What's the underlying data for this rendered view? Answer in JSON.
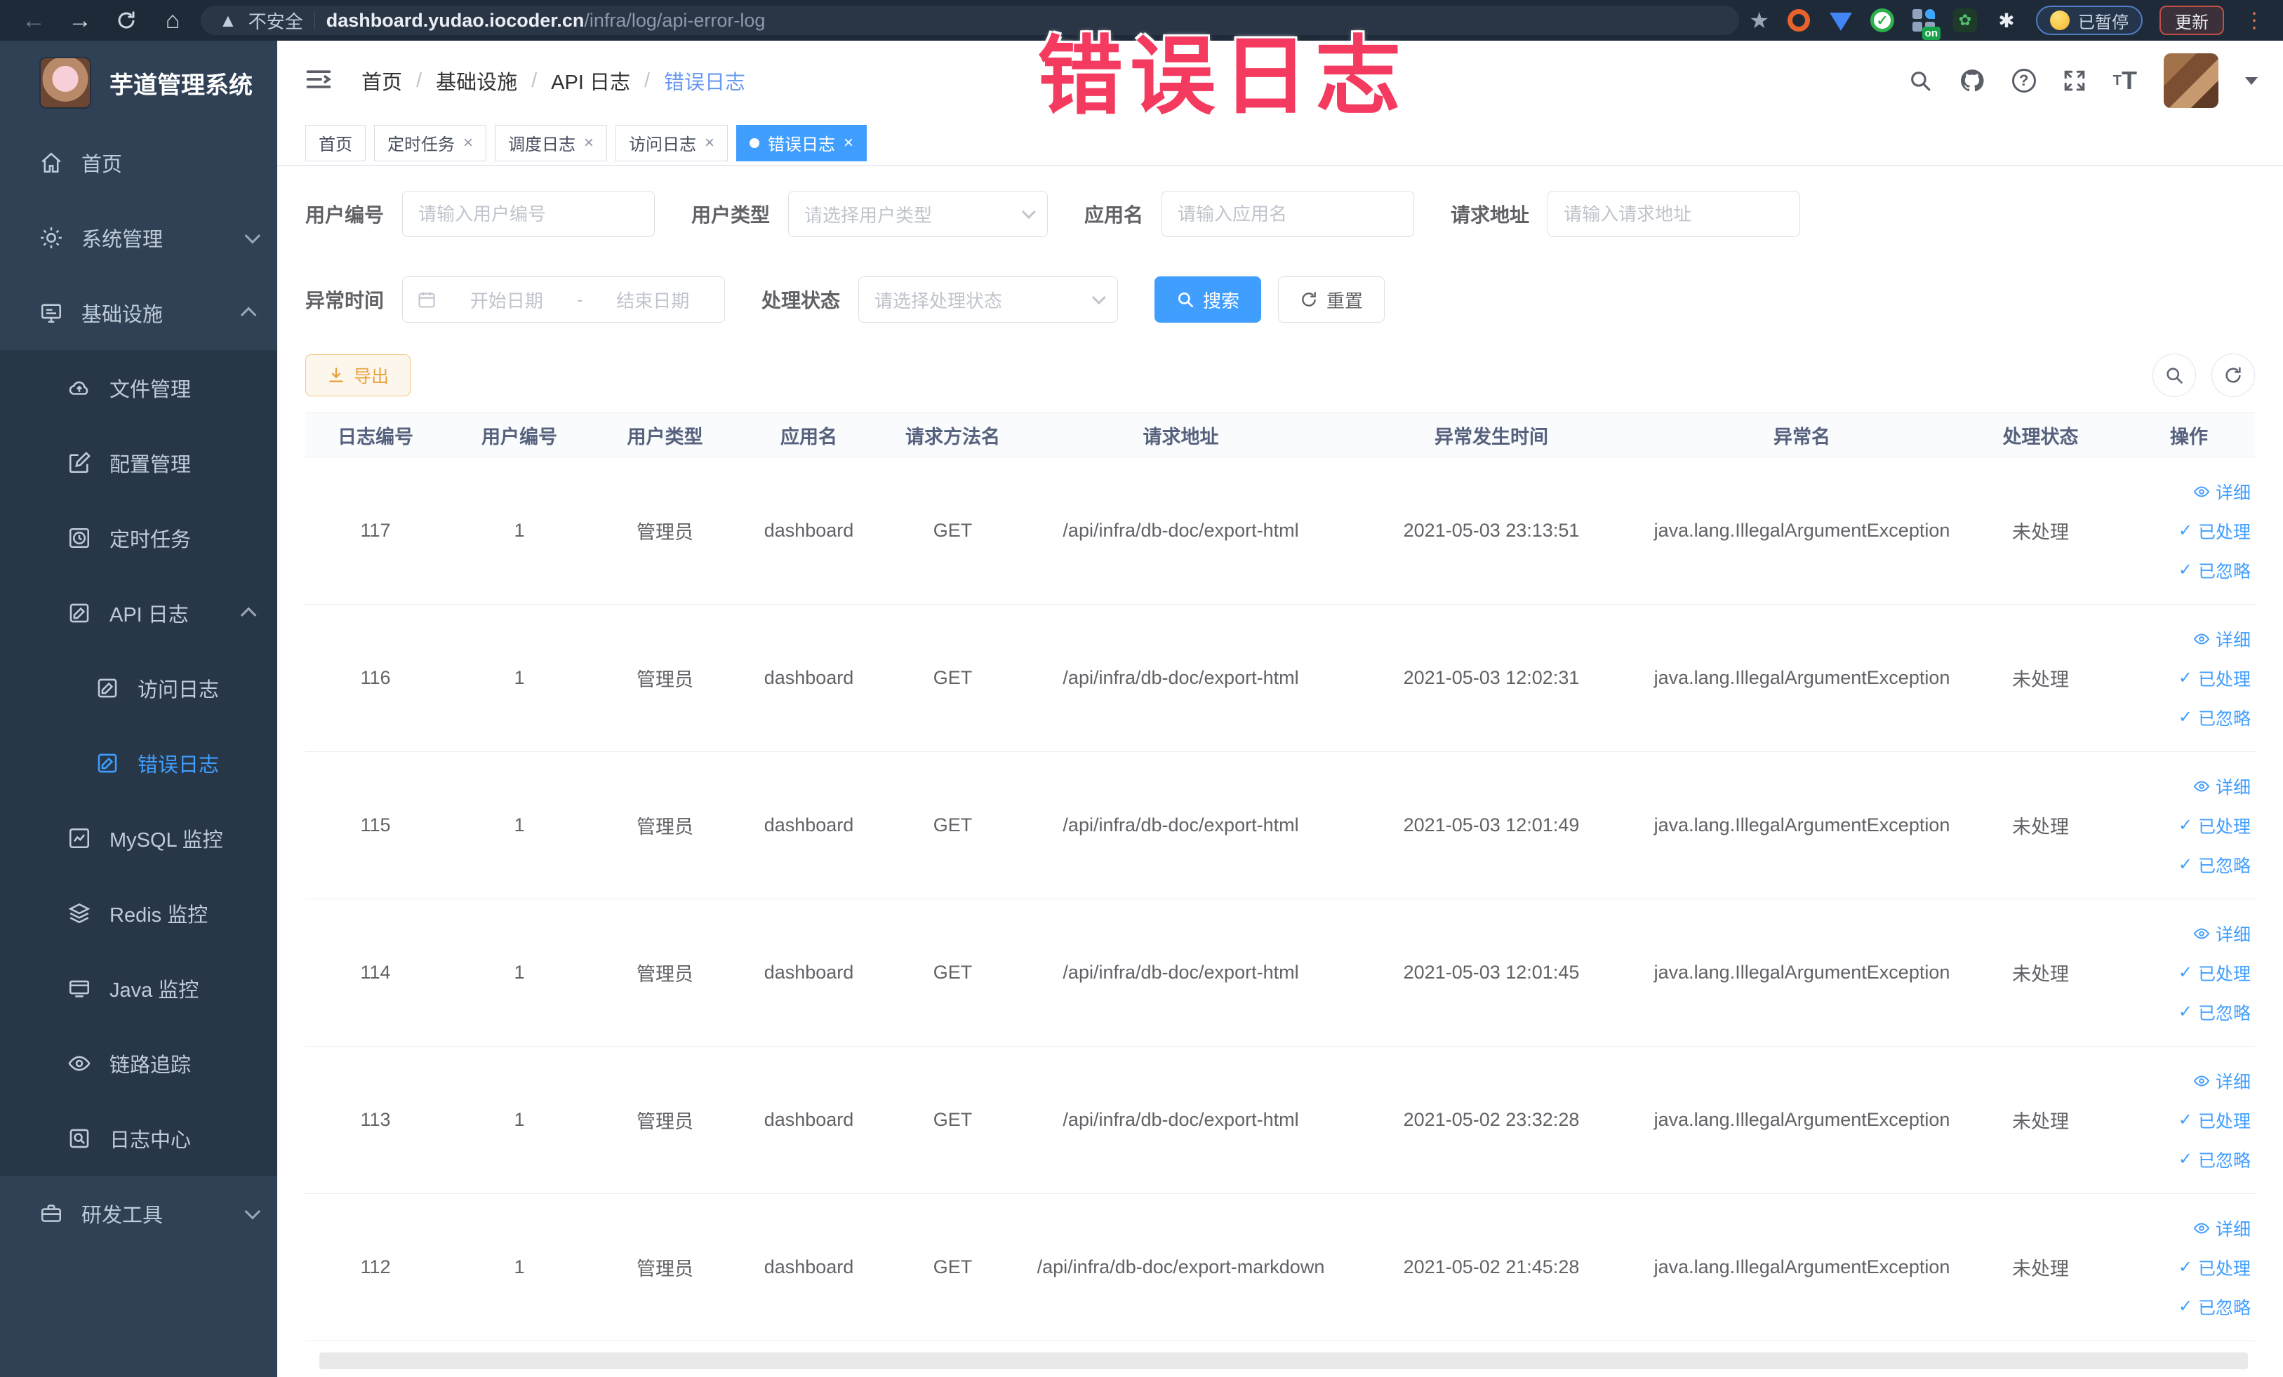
{
  "browser": {
    "security_label": "不安全",
    "url_domain": "dashboard.yudao.iocoder.cn",
    "url_path": "/infra/log/api-error-log",
    "paused_label": "已暂停",
    "update_label": "更新"
  },
  "annotation": {
    "text": "错误日志",
    "color": "#f43b5f"
  },
  "sidebar": {
    "title": "芋道管理系统",
    "items": [
      {
        "label": "首页"
      },
      {
        "label": "系统管理"
      },
      {
        "label": "基础设施"
      },
      {
        "label": "文件管理"
      },
      {
        "label": "配置管理"
      },
      {
        "label": "定时任务"
      },
      {
        "label": "API 日志"
      },
      {
        "label": "访问日志"
      },
      {
        "label": "错误日志"
      },
      {
        "label": "MySQL 监控"
      },
      {
        "label": "Redis 监控"
      },
      {
        "label": "Java 监控"
      },
      {
        "label": "链路追踪"
      },
      {
        "label": "日志中心"
      },
      {
        "label": "研发工具"
      }
    ]
  },
  "breadcrumb": {
    "items": [
      "首页",
      "基础设施",
      "API 日志",
      "错误日志"
    ]
  },
  "tabs": [
    {
      "label": "首页"
    },
    {
      "label": "定时任务"
    },
    {
      "label": "调度日志"
    },
    {
      "label": "访问日志"
    },
    {
      "label": "错误日志"
    }
  ],
  "filters": {
    "user_id": {
      "label": "用户编号",
      "placeholder": "请输入用户编号"
    },
    "user_type": {
      "label": "用户类型",
      "placeholder": "请选择用户类型"
    },
    "app_name": {
      "label": "应用名",
      "placeholder": "请输入应用名"
    },
    "request_url": {
      "label": "请求地址",
      "placeholder": "请输入请求地址"
    },
    "exception_time": {
      "label": "异常时间",
      "start_placeholder": "开始日期",
      "separator": "-",
      "end_placeholder": "结束日期"
    },
    "process_status": {
      "label": "处理状态",
      "placeholder": "请选择处理状态"
    },
    "search_label": "搜索",
    "reset_label": "重置"
  },
  "toolbar": {
    "export_label": "导出"
  },
  "table": {
    "columns": [
      "日志编号",
      "用户编号",
      "用户类型",
      "应用名",
      "请求方法名",
      "请求地址",
      "异常发生时间",
      "异常名",
      "处理状态",
      "操作"
    ],
    "actions": {
      "detail": "详细",
      "processed": "已处理",
      "ignored": "已忽略"
    },
    "rows": [
      {
        "id": "117",
        "user_id": "1",
        "user_type": "管理员",
        "app": "dashboard",
        "method": "GET",
        "url": "/api/infra/db-doc/export-html",
        "time": "2021-05-03 23:13:51",
        "exception": "java.lang.IllegalArgumentException",
        "status": "未处理"
      },
      {
        "id": "116",
        "user_id": "1",
        "user_type": "管理员",
        "app": "dashboard",
        "method": "GET",
        "url": "/api/infra/db-doc/export-html",
        "time": "2021-05-03 12:02:31",
        "exception": "java.lang.IllegalArgumentException",
        "status": "未处理"
      },
      {
        "id": "115",
        "user_id": "1",
        "user_type": "管理员",
        "app": "dashboard",
        "method": "GET",
        "url": "/api/infra/db-doc/export-html",
        "time": "2021-05-03 12:01:49",
        "exception": "java.lang.IllegalArgumentException",
        "status": "未处理"
      },
      {
        "id": "114",
        "user_id": "1",
        "user_type": "管理员",
        "app": "dashboard",
        "method": "GET",
        "url": "/api/infra/db-doc/export-html",
        "time": "2021-05-03 12:01:45",
        "exception": "java.lang.IllegalArgumentException",
        "status": "未处理"
      },
      {
        "id": "113",
        "user_id": "1",
        "user_type": "管理员",
        "app": "dashboard",
        "method": "GET",
        "url": "/api/infra/db-doc/export-html",
        "time": "2021-05-02 23:32:28",
        "exception": "java.lang.IllegalArgumentException",
        "status": "未处理"
      },
      {
        "id": "112",
        "user_id": "1",
        "user_type": "管理员",
        "app": "dashboard",
        "method": "GET",
        "url": "/api/infra/db-doc/export-markdown",
        "time": "2021-05-02 21:45:28",
        "exception": "java.lang.IllegalArgumentException",
        "status": "未处理"
      }
    ]
  },
  "colors": {
    "accent": "#409EFF",
    "warning": "#E6A23C",
    "sidebar_bg": "#304156",
    "annotation": "#F43B5F",
    "browser_bar": "#1F2A39"
  }
}
